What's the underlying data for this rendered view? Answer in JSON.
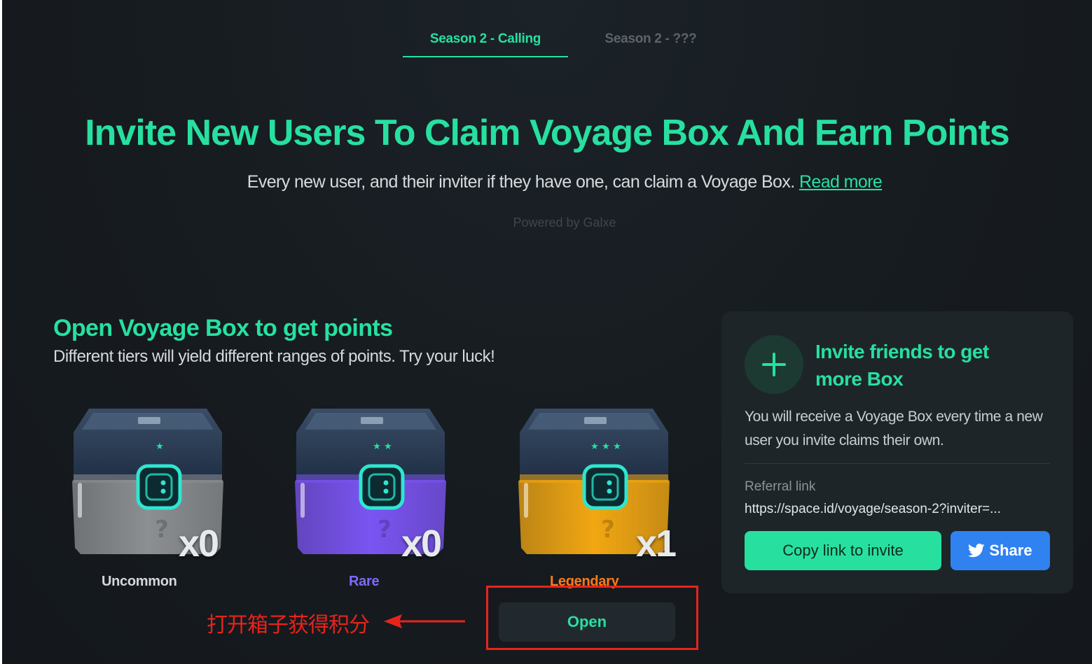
{
  "tabs": [
    {
      "label": "Season 2 - Calling",
      "active": true
    },
    {
      "label": "Season 2 - ???",
      "active": false
    }
  ],
  "hero": {
    "title": "Invite New Users To Claim Voyage Box And Earn Points",
    "subtitle": "Every new user, and their inviter if they have one, can claim a Voyage Box.",
    "read_more": "Read more",
    "powered_by": "Powered by Galxe"
  },
  "boxes_section": {
    "title": "Open Voyage Box to get points",
    "subtitle": "Different tiers will yield different ranges of points. Try your luck!",
    "boxes": [
      {
        "label": "Uncommon",
        "count": "x0",
        "stars": 1,
        "color": "#8c8f92",
        "label_color": "#d4d8db"
      },
      {
        "label": "Rare",
        "count": "x0",
        "stars": 2,
        "color": "#7b54f2",
        "label_color": "#7d6bff"
      },
      {
        "label": "Legendary",
        "count": "x1",
        "stars": 3,
        "color": "#f2a712",
        "label_color": "#ff7a1a"
      }
    ],
    "open_button": "Open"
  },
  "annotation": {
    "text": "打开箱子获得积分",
    "color": "#e8231c"
  },
  "invite_card": {
    "title": "Invite friends to get more Box",
    "description": "You will receive a Voyage Box every time a new user you invite claims their own.",
    "referral_label": "Referral link",
    "referral_link": "https://space.id/voyage/season-2?inviter=...",
    "copy_button": "Copy link to invite",
    "share_button": "Share"
  },
  "colors": {
    "accent": "#27e0a0",
    "background": "#161b1f",
    "card": "#1e2529",
    "twitter": "#2f82f0"
  }
}
